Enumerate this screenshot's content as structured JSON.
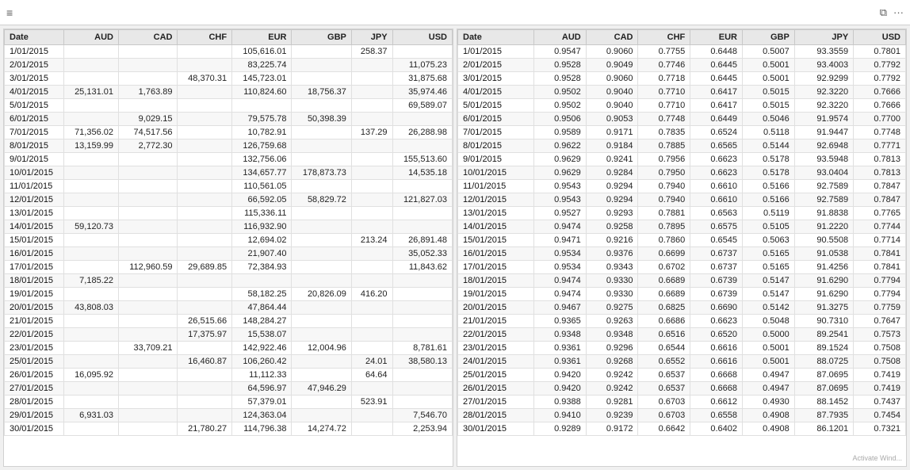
{
  "titleBar": {
    "hamburgerLabel": "≡",
    "restoreLabel": "⧉",
    "moreLabel": "···"
  },
  "leftTable": {
    "headers": [
      "Date",
      "AUD",
      "CAD",
      "CHF",
      "EUR",
      "GBP",
      "JPY",
      "USD"
    ],
    "rows": [
      [
        "1/01/2015",
        "",
        "",
        "",
        "105,616.01",
        "",
        "258.37",
        ""
      ],
      [
        "2/01/2015",
        "",
        "",
        "",
        "83,225.74",
        "",
        "",
        "11,075.23"
      ],
      [
        "3/01/2015",
        "",
        "",
        "48,370.31",
        "145,723.01",
        "",
        "",
        "31,875.68"
      ],
      [
        "4/01/2015",
        "25,131.01",
        "1,763.89",
        "",
        "110,824.60",
        "18,756.37",
        "",
        "35,974.46"
      ],
      [
        "5/01/2015",
        "",
        "",
        "",
        "",
        "",
        "",
        "69,589.07"
      ],
      [
        "6/01/2015",
        "",
        "9,029.15",
        "",
        "79,575.78",
        "50,398.39",
        "",
        ""
      ],
      [
        "7/01/2015",
        "71,356.02",
        "74,517.56",
        "",
        "10,782.91",
        "",
        "137.29",
        "26,288.98"
      ],
      [
        "8/01/2015",
        "13,159.99",
        "2,772.30",
        "",
        "126,759.68",
        "",
        "",
        ""
      ],
      [
        "9/01/2015",
        "",
        "",
        "",
        "132,756.06",
        "",
        "",
        "155,513.60"
      ],
      [
        "10/01/2015",
        "",
        "",
        "",
        "134,657.77",
        "178,873.73",
        "",
        "14,535.18"
      ],
      [
        "11/01/2015",
        "",
        "",
        "",
        "110,561.05",
        "",
        "",
        ""
      ],
      [
        "12/01/2015",
        "",
        "",
        "",
        "66,592.05",
        "58,829.72",
        "",
        "121,827.03"
      ],
      [
        "13/01/2015",
        "",
        "",
        "",
        "115,336.11",
        "",
        "",
        ""
      ],
      [
        "14/01/2015",
        "59,120.73",
        "",
        "",
        "116,932.90",
        "",
        "",
        ""
      ],
      [
        "15/01/2015",
        "",
        "",
        "",
        "12,694.02",
        "",
        "213.24",
        "26,891.48"
      ],
      [
        "16/01/2015",
        "",
        "",
        "",
        "21,907.40",
        "",
        "",
        "35,052.33"
      ],
      [
        "17/01/2015",
        "",
        "112,960.59",
        "29,689.85",
        "72,384.93",
        "",
        "",
        "11,843.62"
      ],
      [
        "18/01/2015",
        "7,185.22",
        "",
        "",
        "",
        "",
        "",
        ""
      ],
      [
        "19/01/2015",
        "",
        "",
        "",
        "58,182.25",
        "20,826.09",
        "416.20",
        ""
      ],
      [
        "20/01/2015",
        "43,808.03",
        "",
        "",
        "47,864.44",
        "",
        "",
        ""
      ],
      [
        "21/01/2015",
        "",
        "",
        "26,515.66",
        "148,284.27",
        "",
        "",
        ""
      ],
      [
        "22/01/2015",
        "",
        "",
        "17,375.97",
        "15,538.07",
        "",
        "",
        ""
      ],
      [
        "23/01/2015",
        "",
        "33,709.21",
        "",
        "142,922.46",
        "12,004.96",
        "",
        "8,781.61"
      ],
      [
        "25/01/2015",
        "",
        "",
        "16,460.87",
        "106,260.42",
        "",
        "24.01",
        "38,580.13"
      ],
      [
        "26/01/2015",
        "16,095.92",
        "",
        "",
        "11,112.33",
        "",
        "64.64",
        ""
      ],
      [
        "27/01/2015",
        "",
        "",
        "",
        "64,596.97",
        "47,946.29",
        "",
        ""
      ],
      [
        "28/01/2015",
        "",
        "",
        "",
        "57,379.01",
        "",
        "523.91",
        ""
      ],
      [
        "29/01/2015",
        "6,931.03",
        "",
        "",
        "124,363.04",
        "",
        "",
        "7,546.70"
      ],
      [
        "30/01/2015",
        "",
        "",
        "21,780.27",
        "114,796.38",
        "14,274.72",
        "",
        "2,253.94"
      ]
    ]
  },
  "rightTable": {
    "headers": [
      "Date",
      "AUD",
      "CAD",
      "CHF",
      "EUR",
      "GBP",
      "JPY",
      "USD"
    ],
    "rows": [
      [
        "1/01/2015",
        "0.9547",
        "0.9060",
        "0.7755",
        "0.6448",
        "0.5007",
        "93.3559",
        "0.7801"
      ],
      [
        "2/01/2015",
        "0.9528",
        "0.9049",
        "0.7746",
        "0.6445",
        "0.5001",
        "93.4003",
        "0.7792"
      ],
      [
        "3/01/2015",
        "0.9528",
        "0.9060",
        "0.7718",
        "0.6445",
        "0.5001",
        "92.9299",
        "0.7792"
      ],
      [
        "4/01/2015",
        "0.9502",
        "0.9040",
        "0.7710",
        "0.6417",
        "0.5015",
        "92.3220",
        "0.7666"
      ],
      [
        "5/01/2015",
        "0.9502",
        "0.9040",
        "0.7710",
        "0.6417",
        "0.5015",
        "92.3220",
        "0.7666"
      ],
      [
        "6/01/2015",
        "0.9506",
        "0.9053",
        "0.7748",
        "0.6449",
        "0.5046",
        "91.9574",
        "0.7700"
      ],
      [
        "7/01/2015",
        "0.9589",
        "0.9171",
        "0.7835",
        "0.6524",
        "0.5118",
        "91.9447",
        "0.7748"
      ],
      [
        "8/01/2015",
        "0.9622",
        "0.9184",
        "0.7885",
        "0.6565",
        "0.5144",
        "92.6948",
        "0.7771"
      ],
      [
        "9/01/2015",
        "0.9629",
        "0.9241",
        "0.7956",
        "0.6623",
        "0.5178",
        "93.5948",
        "0.7813"
      ],
      [
        "10/01/2015",
        "0.9629",
        "0.9284",
        "0.7950",
        "0.6623",
        "0.5178",
        "93.0404",
        "0.7813"
      ],
      [
        "11/01/2015",
        "0.9543",
        "0.9294",
        "0.7940",
        "0.6610",
        "0.5166",
        "92.7589",
        "0.7847"
      ],
      [
        "12/01/2015",
        "0.9543",
        "0.9294",
        "0.7940",
        "0.6610",
        "0.5166",
        "92.7589",
        "0.7847"
      ],
      [
        "13/01/2015",
        "0.9527",
        "0.9293",
        "0.7881",
        "0.6563",
        "0.5119",
        "91.8838",
        "0.7765"
      ],
      [
        "14/01/2015",
        "0.9474",
        "0.9258",
        "0.7895",
        "0.6575",
        "0.5105",
        "91.2220",
        "0.7744"
      ],
      [
        "15/01/2015",
        "0.9471",
        "0.9216",
        "0.7860",
        "0.6545",
        "0.5063",
        "90.5508",
        "0.7714"
      ],
      [
        "16/01/2015",
        "0.9534",
        "0.9376",
        "0.6699",
        "0.6737",
        "0.5165",
        "91.0538",
        "0.7841"
      ],
      [
        "17/01/2015",
        "0.9534",
        "0.9343",
        "0.6702",
        "0.6737",
        "0.5165",
        "91.4256",
        "0.7841"
      ],
      [
        "18/01/2015",
        "0.9474",
        "0.9330",
        "0.6689",
        "0.6739",
        "0.5147",
        "91.6290",
        "0.7794"
      ],
      [
        "19/01/2015",
        "0.9474",
        "0.9330",
        "0.6689",
        "0.6739",
        "0.5147",
        "91.6290",
        "0.7794"
      ],
      [
        "20/01/2015",
        "0.9467",
        "0.9275",
        "0.6825",
        "0.6690",
        "0.5142",
        "91.3275",
        "0.7759"
      ],
      [
        "21/01/2015",
        "0.9365",
        "0.9263",
        "0.6686",
        "0.6623",
        "0.5048",
        "90.7310",
        "0.7647"
      ],
      [
        "22/01/2015",
        "0.9348",
        "0.9348",
        "0.6516",
        "0.6520",
        "0.5000",
        "89.2541",
        "0.7573"
      ],
      [
        "23/01/2015",
        "0.9361",
        "0.9296",
        "0.6544",
        "0.6616",
        "0.5001",
        "89.1524",
        "0.7508"
      ],
      [
        "24/01/2015",
        "0.9361",
        "0.9268",
        "0.6552",
        "0.6616",
        "0.5001",
        "88.0725",
        "0.7508"
      ],
      [
        "25/01/2015",
        "0.9420",
        "0.9242",
        "0.6537",
        "0.6668",
        "0.4947",
        "87.0695",
        "0.7419"
      ],
      [
        "26/01/2015",
        "0.9420",
        "0.9242",
        "0.6537",
        "0.6668",
        "0.4947",
        "87.0695",
        "0.7419"
      ],
      [
        "27/01/2015",
        "0.9388",
        "0.9281",
        "0.6703",
        "0.6612",
        "0.4930",
        "88.1452",
        "0.7437"
      ],
      [
        "28/01/2015",
        "0.9410",
        "0.9239",
        "0.6703",
        "0.6558",
        "0.4908",
        "87.7935",
        "0.7454"
      ],
      [
        "30/01/2015",
        "0.9289",
        "0.9172",
        "0.6642",
        "0.6402",
        "0.4908",
        "86.1201",
        "0.7321"
      ]
    ]
  },
  "watermark": "Activate Wind..."
}
